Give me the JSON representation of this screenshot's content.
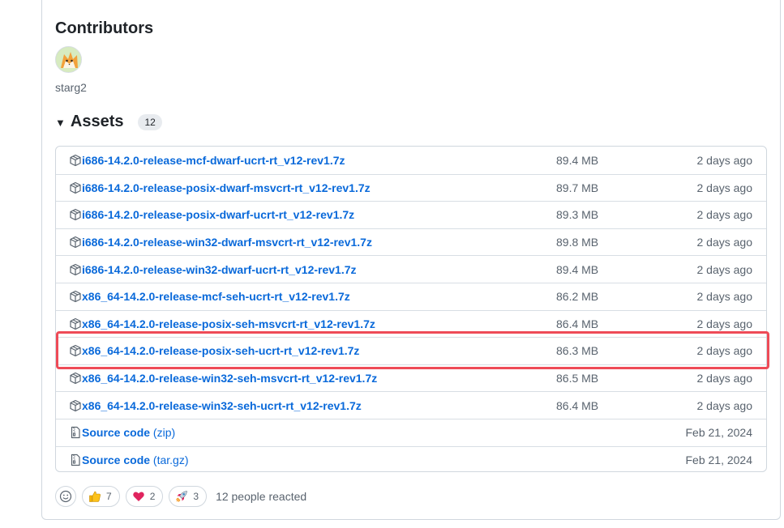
{
  "contributors": {
    "title": "Contributors",
    "people": [
      {
        "name": "starg2",
        "avatar": "fox-avatar"
      }
    ]
  },
  "assets": {
    "title": "Assets",
    "count": "12",
    "rows": [
      {
        "name": "i686-14.2.0-release-mcf-dwarf-ucrt-rt_v12-rev1.7z",
        "suffix": "",
        "size": "89.4 MB",
        "date": "2 days ago",
        "icon": "package-icon"
      },
      {
        "name": "i686-14.2.0-release-posix-dwarf-msvcrt-rt_v12-rev1.7z",
        "suffix": "",
        "size": "89.7 MB",
        "date": "2 days ago",
        "icon": "package-icon"
      },
      {
        "name": "i686-14.2.0-release-posix-dwarf-ucrt-rt_v12-rev1.7z",
        "suffix": "",
        "size": "89.3 MB",
        "date": "2 days ago",
        "icon": "package-icon"
      },
      {
        "name": "i686-14.2.0-release-win32-dwarf-msvcrt-rt_v12-rev1.7z",
        "suffix": "",
        "size": "89.8 MB",
        "date": "2 days ago",
        "icon": "package-icon"
      },
      {
        "name": "i686-14.2.0-release-win32-dwarf-ucrt-rt_v12-rev1.7z",
        "suffix": "",
        "size": "89.4 MB",
        "date": "2 days ago",
        "icon": "package-icon"
      },
      {
        "name": "x86_64-14.2.0-release-mcf-seh-ucrt-rt_v12-rev1.7z",
        "suffix": "",
        "size": "86.2 MB",
        "date": "2 days ago",
        "icon": "package-icon"
      },
      {
        "name": "x86_64-14.2.0-release-posix-seh-msvcrt-rt_v12-rev1.7z",
        "suffix": "",
        "size": "86.4 MB",
        "date": "2 days ago",
        "icon": "package-icon"
      },
      {
        "name": "x86_64-14.2.0-release-posix-seh-ucrt-rt_v12-rev1.7z",
        "suffix": "",
        "size": "86.3 MB",
        "date": "2 days ago",
        "icon": "package-icon",
        "highlighted": true
      },
      {
        "name": "x86_64-14.2.0-release-win32-seh-msvcrt-rt_v12-rev1.7z",
        "suffix": "",
        "size": "86.5 MB",
        "date": "2 days ago",
        "icon": "package-icon"
      },
      {
        "name": "x86_64-14.2.0-release-win32-seh-ucrt-rt_v12-rev1.7z",
        "suffix": "",
        "size": "86.4 MB",
        "date": "2 days ago",
        "icon": "package-icon"
      },
      {
        "name": "Source code",
        "suffix": "(zip)",
        "size": "",
        "date": "Feb 21, 2024",
        "icon": "file-zip-icon"
      },
      {
        "name": "Source code",
        "suffix": "(tar.gz)",
        "size": "",
        "date": "Feb 21, 2024",
        "icon": "file-zip-icon"
      }
    ]
  },
  "reactions": {
    "items": [
      {
        "emoji": "thumbs-up",
        "count": "7"
      },
      {
        "emoji": "heart",
        "count": "2"
      },
      {
        "emoji": "rocket",
        "count": "3"
      }
    ],
    "summary": "12 people reacted"
  },
  "colors": {
    "link": "#0969da",
    "muted": "#59636e",
    "highlight": "#ee4b57",
    "border": "#d0d7de"
  }
}
